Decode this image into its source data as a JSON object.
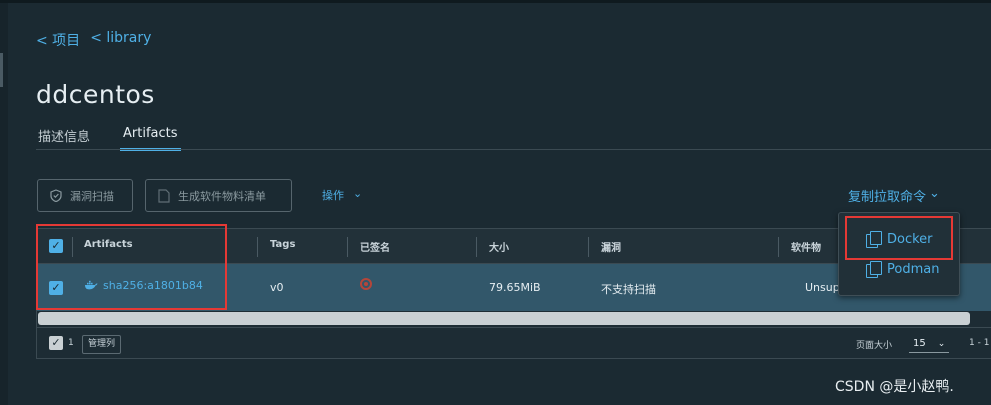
{
  "breadcrumb": {
    "projects": "< 项目",
    "library": "< library"
  },
  "page": {
    "title": "ddcentos"
  },
  "tabs": [
    {
      "label": "描述信息"
    },
    {
      "label": "Artifacts"
    }
  ],
  "toolbar": {
    "scan_label": "漏洞扫描",
    "sbom_label": "生成软件物料清单",
    "ops_label": "操作",
    "copy_cmd_label": "复制拉取命令"
  },
  "table": {
    "headers": [
      "Artifacts",
      "Tags",
      "已签名",
      "大小",
      "漏洞",
      "软件物"
    ],
    "rows": [
      {
        "artifact": "sha256:a1801b84",
        "tags": "v0",
        "size": "79.65MiB",
        "vuln": "不支持扫描",
        "sbom": "Unsup"
      }
    ],
    "selected_count": "1",
    "manage_cols_label": "管理列",
    "page_size_label": "页面大小",
    "page_size_value": "15",
    "range_text": "1 - 1"
  },
  "dropdown": {
    "items": [
      {
        "label": "Docker"
      },
      {
        "label": "Podman"
      }
    ]
  },
  "watermark": "CSDN @是小赵鸭.",
  "colors": {
    "background": "#1b2a32",
    "accent": "#4fb0e6",
    "row_selected": "#32576a",
    "highlight": "#e53935"
  }
}
